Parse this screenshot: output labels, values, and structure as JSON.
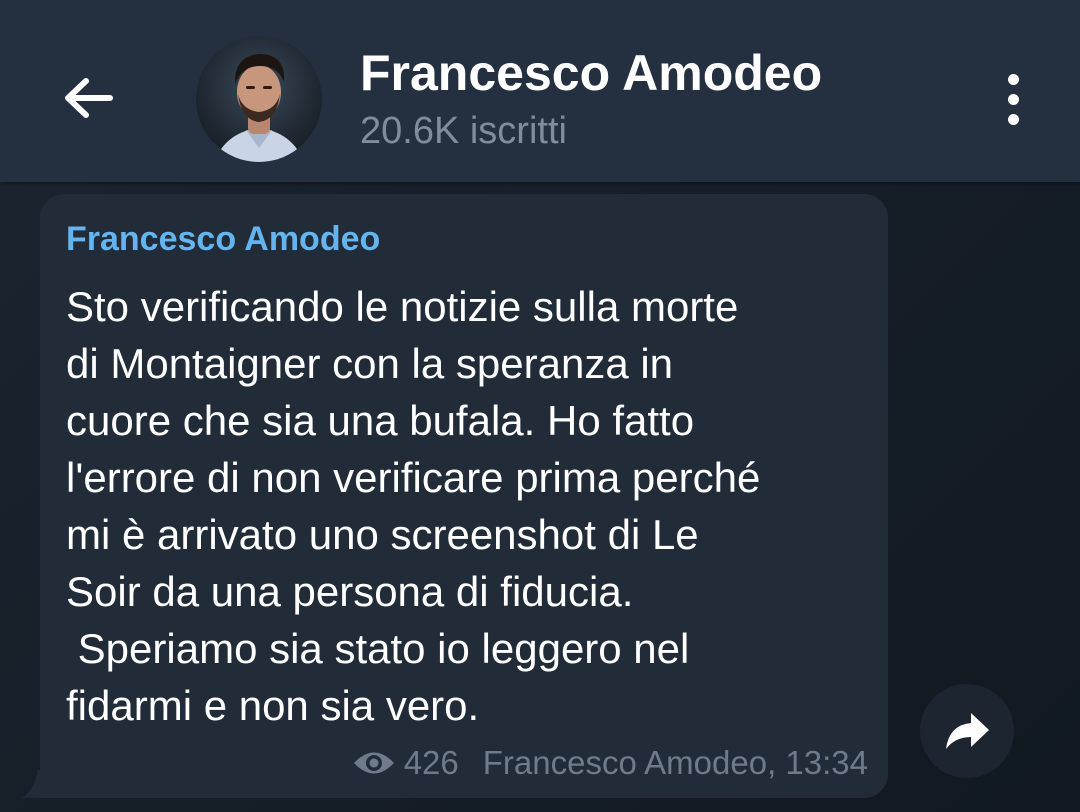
{
  "header": {
    "title": "Francesco Amodeo",
    "subtitle": "20.6K iscritti",
    "back_icon": "arrow-left-icon",
    "menu_icon": "more-vertical-icon"
  },
  "message": {
    "sender": "Francesco Amodeo",
    "text": "Sto verificando le notizie sulla morte\ndi Montaigner con la speranza in\ncuore che sia una bufala. Ho fatto\nl'errore di non verificare prima perché\nmi è arrivato uno screenshot di Le\nSoir da una persona di fiducia.\n Speriamo sia stato io leggero nel\nfidarmi e non sia vero.",
    "views": "426",
    "signature": "Francesco Amodeo, 13:34",
    "views_icon": "eye-icon"
  },
  "actions": {
    "share_icon": "forward-arrow-icon"
  },
  "colors": {
    "header_bg": "#243040",
    "chat_bg": "#1a222c",
    "bubble_bg": "#222c38",
    "sender_name": "#64b5ef",
    "meta_text": "#6d7b8a",
    "subtitle_text": "#7f8d9c"
  }
}
